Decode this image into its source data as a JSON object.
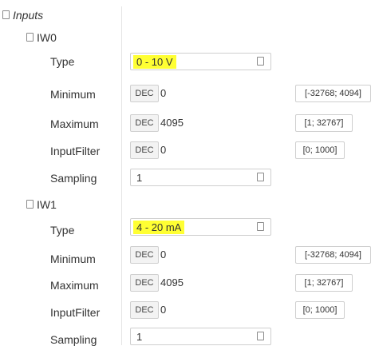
{
  "tree": {
    "root": {
      "label": "Inputs",
      "icon": "collapse-icon"
    },
    "channels": [
      {
        "label": "IW0",
        "properties": {
          "type": {
            "label": "Type",
            "value": "0 - 10 V",
            "highlighted": true
          },
          "minimum": {
            "label": "Minimum",
            "format": "DEC",
            "value": "0",
            "range": "[-32768; 4094]"
          },
          "maximum": {
            "label": "Maximum",
            "format": "DEC",
            "value": "4095",
            "range": "[1; 32767]"
          },
          "input_filter": {
            "label": "InputFilter",
            "format": "DEC",
            "value": "0",
            "range": "[0; 1000]"
          },
          "sampling": {
            "label": "Sampling",
            "value": "1"
          }
        }
      },
      {
        "label": "IW1",
        "properties": {
          "type": {
            "label": "Type",
            "value": "4 - 20 mA",
            "highlighted": true
          },
          "minimum": {
            "label": "Minimum",
            "format": "DEC",
            "value": "0",
            "range": "[-32768; 4094]"
          },
          "maximum": {
            "label": "Maximum",
            "format": "DEC",
            "value": "4095",
            "range": "[1; 32767]"
          },
          "input_filter": {
            "label": "InputFilter",
            "format": "DEC",
            "value": "0",
            "range": "[0; 1000]"
          },
          "sampling": {
            "label": "Sampling",
            "value": "1"
          }
        }
      }
    ]
  },
  "colors": {
    "highlight": "#ffff33",
    "border": "#cfcfcf",
    "text": "#333333"
  }
}
